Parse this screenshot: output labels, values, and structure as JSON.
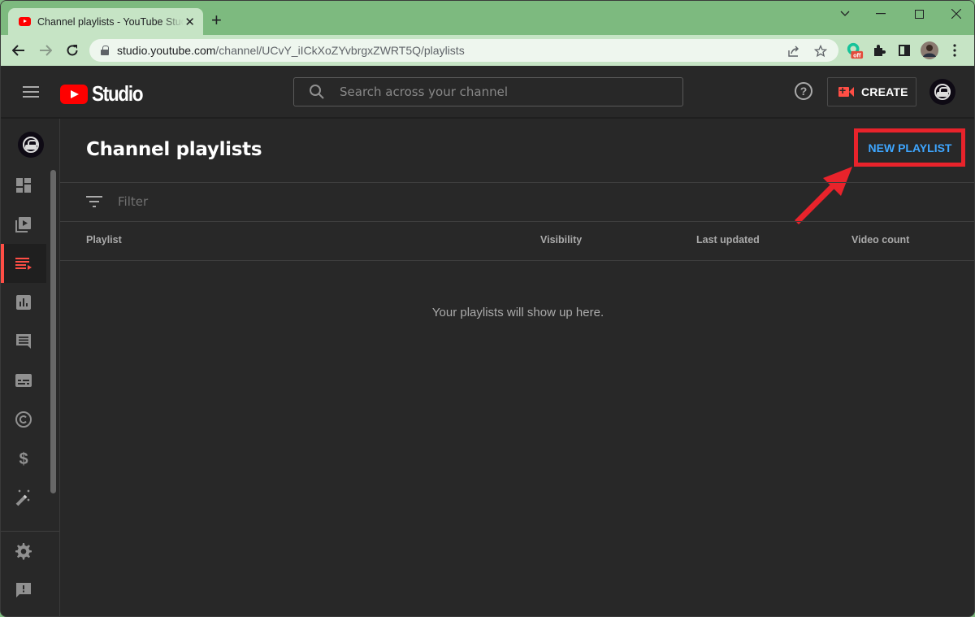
{
  "browser": {
    "tab": {
      "title": "Channel playlists - YouTube Studio",
      "favicon": "youtube-icon"
    },
    "new_tab_glyph": "+",
    "close_glyph": "✕",
    "url": {
      "host": "studio.youtube.com",
      "path": "/channel/UCvY_iICkXoZYvbrgxZWRT5Q/playlists"
    },
    "extensions": [
      {
        "name": "grammarly-extension-icon",
        "badge": "off"
      },
      {
        "name": "extensions-puzzle-icon"
      },
      {
        "name": "side-panel-icon"
      },
      {
        "name": "profile-avatar"
      }
    ],
    "colors": {
      "frame": "#7dba7f",
      "toolbar": "#c6e4c5"
    }
  },
  "header": {
    "logo_text": "Studio",
    "search_placeholder": "Search across your channel",
    "help_glyph": "?",
    "create_label": "CREATE"
  },
  "sidebar": {
    "items": [
      {
        "id": "dashboard",
        "label": "Dashboard",
        "icon": "dashboard-icon"
      },
      {
        "id": "content",
        "label": "Content",
        "icon": "video-library-icon"
      },
      {
        "id": "playlists",
        "label": "Playlists",
        "icon": "playlist-icon",
        "active": true
      },
      {
        "id": "analytics",
        "label": "Analytics",
        "icon": "analytics-icon"
      },
      {
        "id": "comments",
        "label": "Comments",
        "icon": "comments-icon"
      },
      {
        "id": "subtitles",
        "label": "Subtitles",
        "icon": "subtitles-icon"
      },
      {
        "id": "copyright",
        "label": "Copyright",
        "icon": "copyright-icon"
      },
      {
        "id": "earn",
        "label": "Earn",
        "icon": "dollar-icon"
      },
      {
        "id": "customization",
        "label": "Customization",
        "icon": "magic-wand-icon"
      }
    ],
    "bottom": [
      {
        "id": "settings",
        "label": "Settings",
        "icon": "gear-icon"
      },
      {
        "id": "feedback",
        "label": "Send feedback",
        "icon": "feedback-icon"
      }
    ]
  },
  "main": {
    "title": "Channel playlists",
    "new_playlist_label": "NEW PLAYLIST",
    "filter_placeholder": "Filter",
    "columns": [
      "Playlist",
      "Visibility",
      "Last updated",
      "Video count"
    ],
    "rows": [],
    "empty_message": "Your playlists will show up here."
  },
  "annotation": {
    "color": "#e8232b",
    "target": "new-playlist-button"
  },
  "colors": {
    "accent_blue": "#3ea6ff",
    "active_red": "#ff4e45",
    "background": "#282828"
  }
}
